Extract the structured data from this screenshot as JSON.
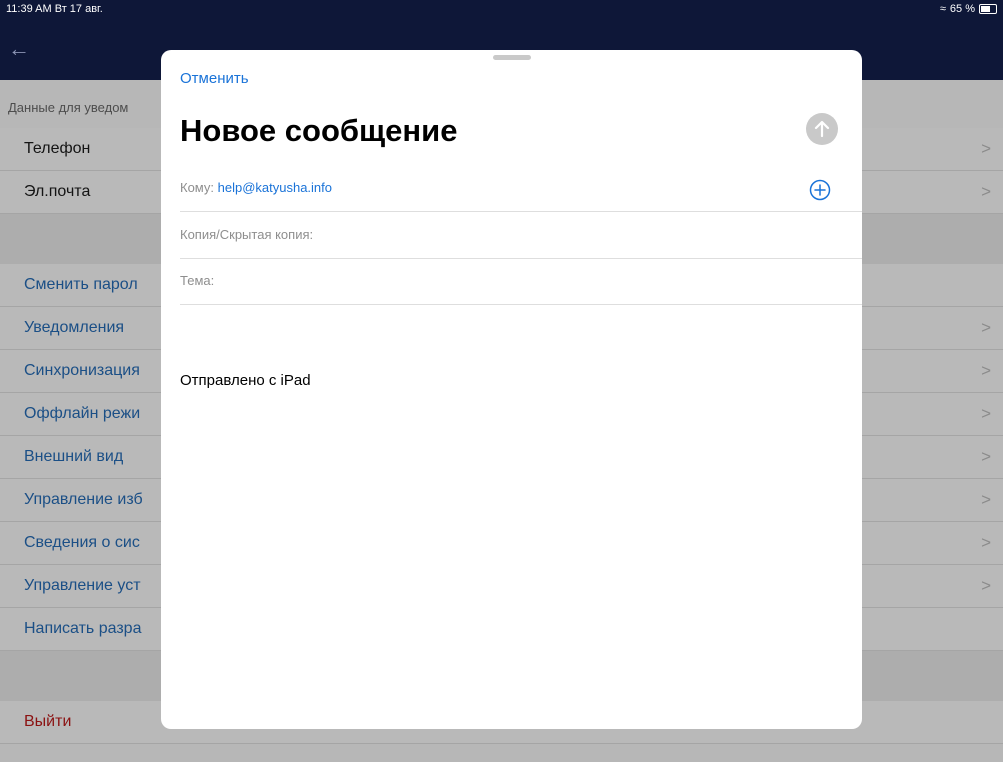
{
  "status": {
    "time": "11:39 AM  Вт 17 авг.",
    "battery_text": "65 %"
  },
  "background": {
    "section_header": "Данные для уведом",
    "rows": [
      {
        "label": "Телефон",
        "style": "dark",
        "chevron": true
      },
      {
        "label": "Эл.почта",
        "style": "dark",
        "chevron": true
      },
      {
        "label": "Сменить парол",
        "style": "blue",
        "chevron": false
      },
      {
        "label": "Уведомления",
        "style": "blue",
        "chevron": true
      },
      {
        "label": "Синхронизация",
        "style": "blue",
        "chevron": true
      },
      {
        "label": "Оффлайн режи",
        "style": "blue",
        "chevron": true
      },
      {
        "label": "Внешний вид",
        "style": "blue",
        "chevron": true
      },
      {
        "label": "Управление изб",
        "style": "blue",
        "chevron": true
      },
      {
        "label": "Сведения о сис",
        "style": "blue",
        "chevron": true
      },
      {
        "label": "Управление уст",
        "style": "blue",
        "chevron": true
      },
      {
        "label": "Написать разра",
        "style": "blue",
        "chevron": false
      },
      {
        "label": "Выйти",
        "style": "red",
        "chevron": false
      }
    ],
    "chevron_glyph": ">"
  },
  "compose": {
    "cancel_label": "Отменить",
    "title": "Новое сообщение",
    "to_label": "Кому:",
    "to_value": "help@katyusha.info",
    "cc_label": "Копия/Скрытая копия:",
    "subject_label": "Тема:",
    "body_signature": "Отправлено с iPad"
  },
  "colors": {
    "accent": "#1a73d8",
    "navbar": "#0e1738",
    "send_disabled": "#c9c9c9"
  }
}
